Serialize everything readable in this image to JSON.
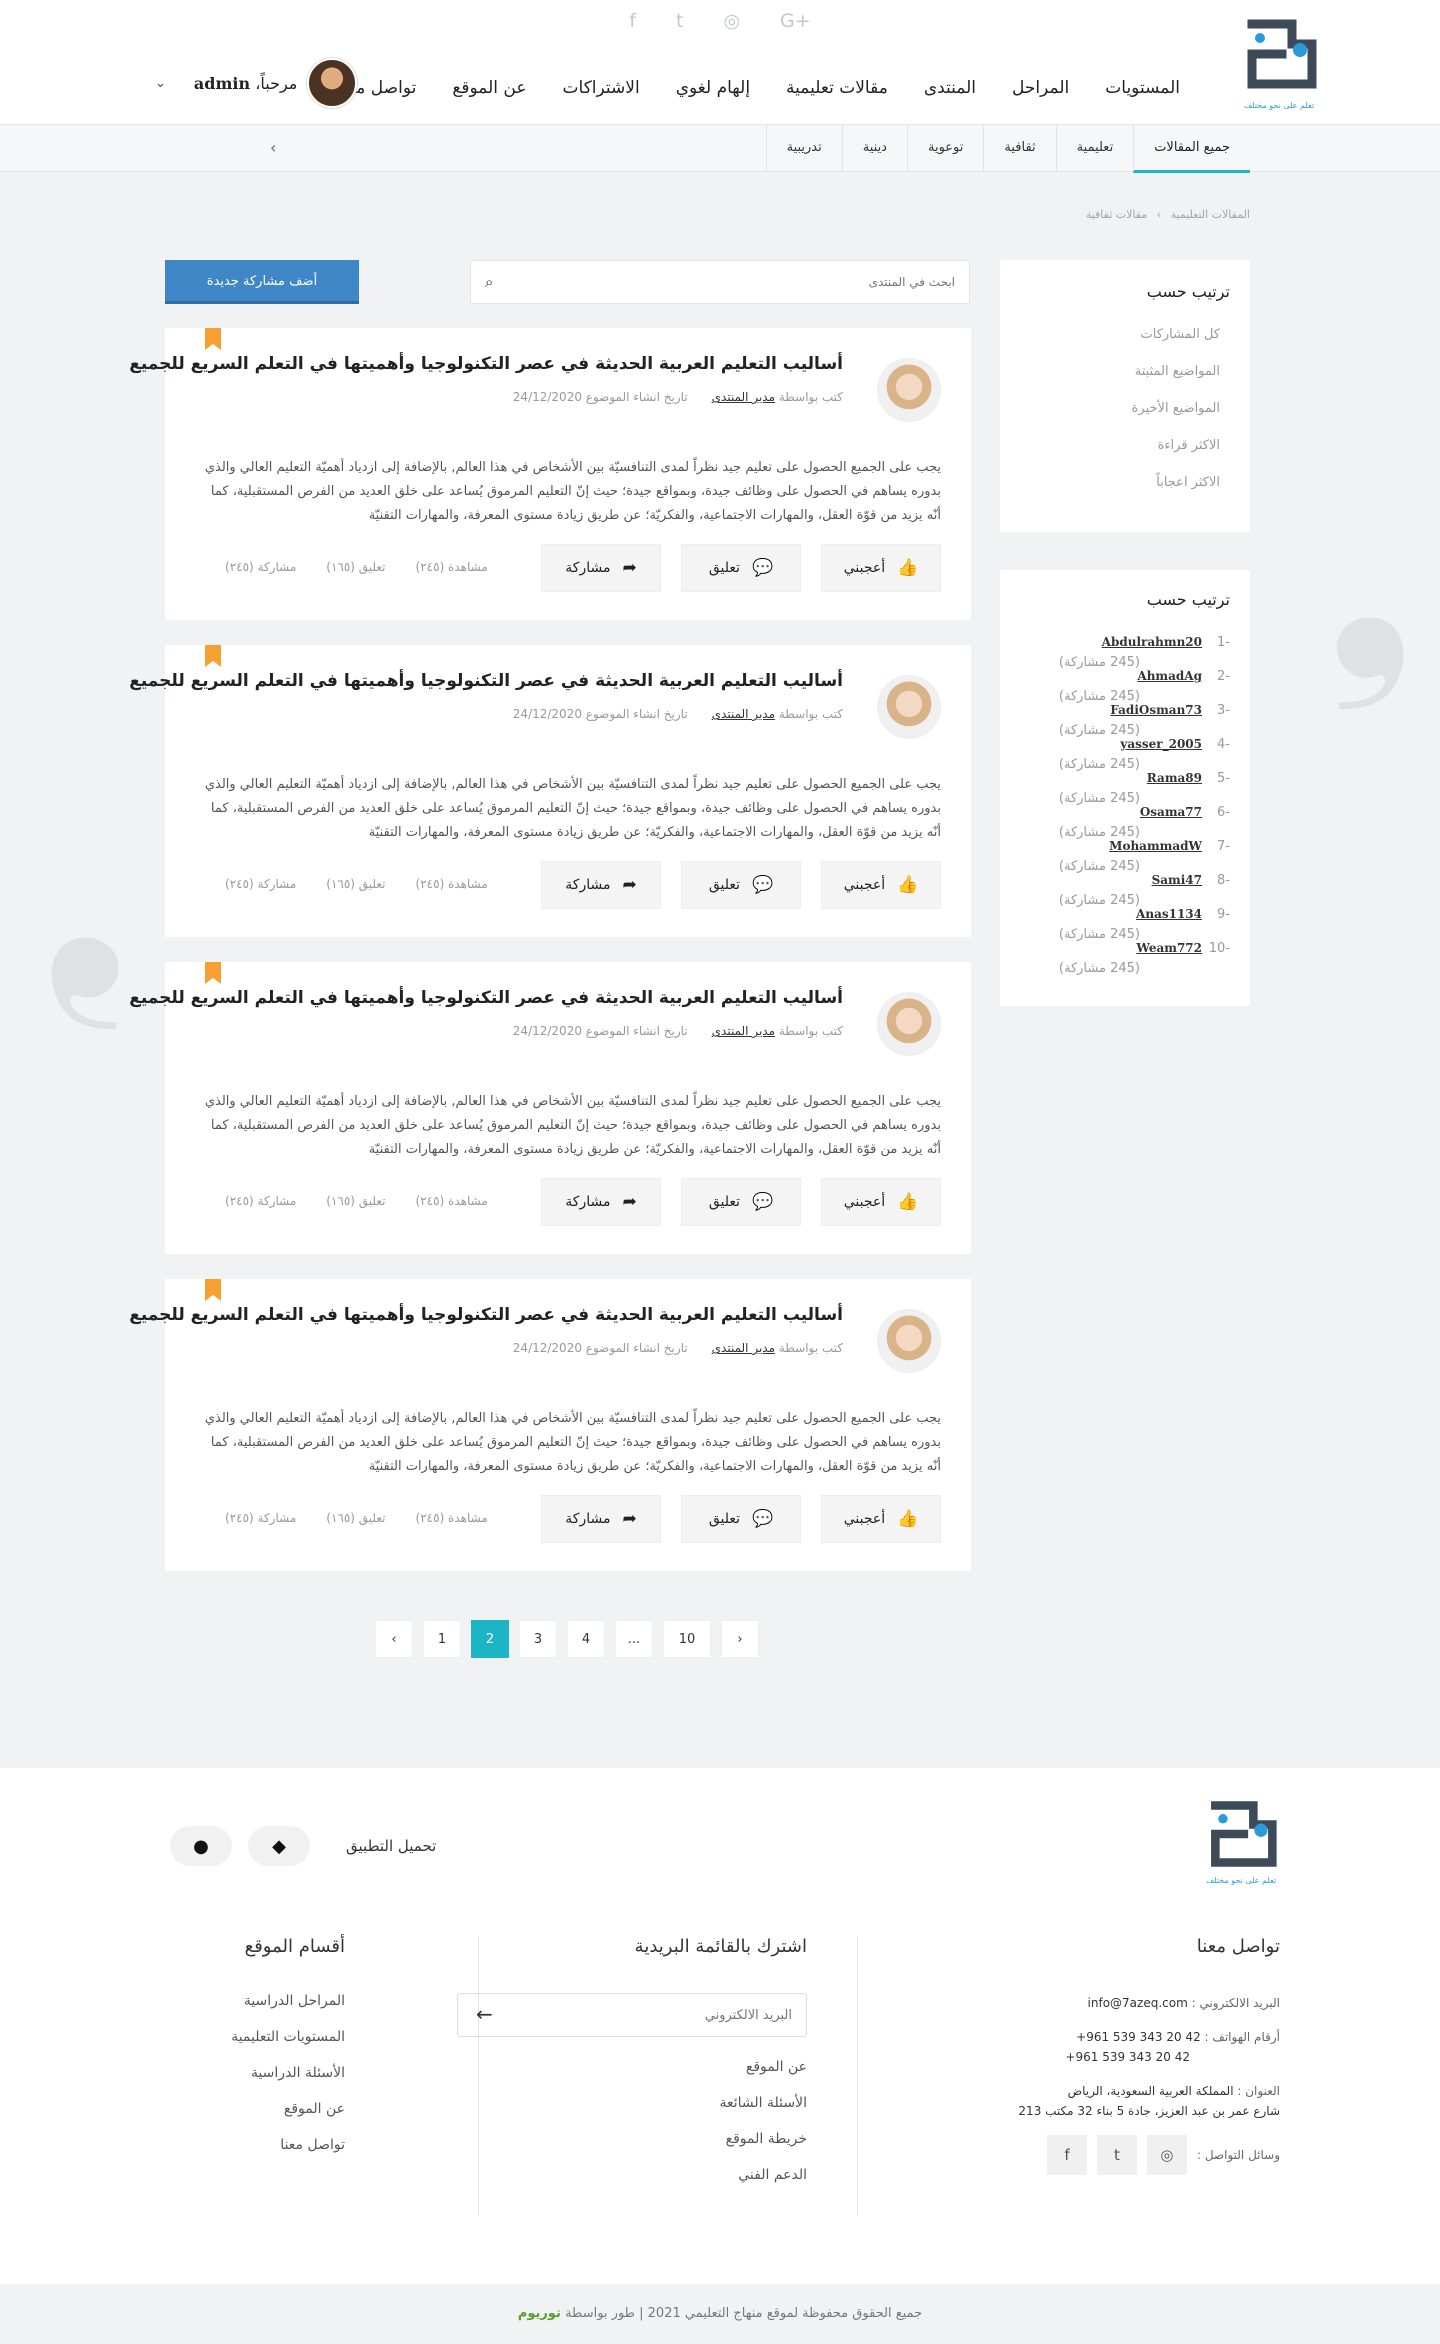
{
  "header": {
    "social": [
      "f",
      "t",
      "◎",
      "G+"
    ],
    "logo_tagline": "تعلم على نحو مختلف",
    "nav": [
      "المستويات",
      "المراحل",
      "المنتدى",
      "مقالات تعليمية",
      "إلهام لغوي",
      "الاشتراكات",
      "عن الموقع",
      "تواصل معنا"
    ],
    "user": {
      "greeting": "مرحباً،",
      "name": "admin",
      "chevron": "⌄"
    }
  },
  "subnav": {
    "tabs": [
      "جميع المقالات",
      "تعليمية",
      "ثقافية",
      "توعوية",
      "دينية",
      "تدريبية"
    ],
    "arrow": "›"
  },
  "breadcrumb": [
    "المقالات التعليمية",
    "›",
    "مقالات ثقافية"
  ],
  "search": {
    "placeholder": "ابحث في المنتدى",
    "icon": "⌕"
  },
  "add_button": "أضف مشاركة جديدة",
  "sort_box": {
    "title": "ترتيب حسب",
    "items": [
      "كل المشاركات",
      "المواضيع المثبتة",
      "المواضيع الأخيرة",
      "الاكثر قراءة",
      "الاكثر اعجاباً"
    ]
  },
  "leaders": {
    "title": "ترتيب حسب",
    "items": [
      {
        "num": "-1",
        "name": "Abdulrahmn20",
        "count": "(245 مشاركة)"
      },
      {
        "num": "-2",
        "name": "AhmadAg",
        "count": "(245 مشاركة)"
      },
      {
        "num": "-3",
        "name": "FadiOsman73",
        "count": "(245 مشاركة)"
      },
      {
        "num": "-4",
        "name": "yasser_2005",
        "count": "(245 مشاركة)"
      },
      {
        "num": "-5",
        "name": "Rama89",
        "count": "(245 مشاركة)"
      },
      {
        "num": "-6",
        "name": "Osama77",
        "count": "(245 مشاركة)"
      },
      {
        "num": "-7",
        "name": "MohammadW",
        "count": "(245 مشاركة)"
      },
      {
        "num": "-8",
        "name": "Sami47",
        "count": "(245 مشاركة)"
      },
      {
        "num": "-9",
        "name": "Anas1134",
        "count": "(245 مشاركة)"
      },
      {
        "num": "-10",
        "name": "Weam772",
        "count": "(245 مشاركة)"
      }
    ]
  },
  "posts": [
    {
      "title": "أساليب التعليم العربية الحديثة في عصر التكنولوجيا وأهميتها في التعلم السريع للجميع",
      "by_label": "كتب بواسطة",
      "author": "مدير المنتدى",
      "date_label": "تاريخ انشاء الموضوع",
      "date": "24/12/2020",
      "body": "يجب على الجميع الحصول على تعليم جيد نظراً لمدى التنافسيّة بين الأشخاص في هذا العالم, بالإضافة إلى ازدياد أهميّة التعليم العالي والذي بدوره يساهم في الحصول على وظائف جيدة، وبمواقع جيدة؛ حيث إنّ التعليم المرموق يُساعد على خلق العديد من الفرص المستقبلية، كما أنّه يزيد من قوّة العقل، والمهارات الاجتماعية، والفكريّة؛ عن طريق زيادة مستوى المعرفة، والمهارات التقنيّة",
      "like": "أعجبني",
      "comment": "تعليق",
      "share": "مشاركة",
      "views": "مشاهدة (٢٤٥)",
      "comments": "تعليق (١٦٥)",
      "shares": "مشاركة (٢٤٥)"
    },
    {
      "title": "أساليب التعليم العربية الحديثة في عصر التكنولوجيا وأهميتها في التعلم السريع للجميع",
      "by_label": "كتب بواسطة",
      "author": "مدير المنتدى",
      "date_label": "تاريخ انشاء الموضوع",
      "date": "24/12/2020",
      "body": "يجب على الجميع الحصول على تعليم جيد نظراً لمدى التنافسيّة بين الأشخاص في هذا العالم, بالإضافة إلى ازدياد أهميّة التعليم العالي والذي بدوره يساهم في الحصول على وظائف جيدة، وبمواقع جيدة؛ حيث إنّ التعليم المرموق يُساعد على خلق العديد من الفرص المستقبلية، كما أنّه يزيد من قوّة العقل، والمهارات الاجتماعية، والفكريّة؛ عن طريق زيادة مستوى المعرفة، والمهارات التقنيّة",
      "like": "أعجبني",
      "comment": "تعليق",
      "share": "مشاركة",
      "views": "مشاهدة (٢٤٥)",
      "comments": "تعليق (١٦٥)",
      "shares": "مشاركة (٢٤٥)"
    },
    {
      "title": "أساليب التعليم العربية الحديثة في عصر التكنولوجيا وأهميتها في التعلم السريع للجميع",
      "by_label": "كتب بواسطة",
      "author": "مدير المنتدى",
      "date_label": "تاريخ انشاء الموضوع",
      "date": "24/12/2020",
      "body": "يجب على الجميع الحصول على تعليم جيد نظراً لمدى التنافسيّة بين الأشخاص في هذا العالم, بالإضافة إلى ازدياد أهميّة التعليم العالي والذي بدوره يساهم في الحصول على وظائف جيدة، وبمواقع جيدة؛ حيث إنّ التعليم المرموق يُساعد على خلق العديد من الفرص المستقبلية، كما أنّه يزيد من قوّة العقل، والمهارات الاجتماعية، والفكريّة؛ عن طريق زيادة مستوى المعرفة، والمهارات التقنيّة",
      "like": "أعجبني",
      "comment": "تعليق",
      "share": "مشاركة",
      "views": "مشاهدة (٢٤٥)",
      "comments": "تعليق (١٦٥)",
      "shares": "مشاركة (٢٤٥)"
    },
    {
      "title": "أساليب التعليم العربية الحديثة في عصر التكنولوجيا وأهميتها في التعلم السريع للجميع",
      "by_label": "كتب بواسطة",
      "author": "مدير المنتدى",
      "date_label": "تاريخ انشاء الموضوع",
      "date": "24/12/2020",
      "body": "يجب على الجميع الحصول على تعليم جيد نظراً لمدى التنافسيّة بين الأشخاص في هذا العالم, بالإضافة إلى ازدياد أهميّة التعليم العالي والذي بدوره يساهم في الحصول على وظائف جيدة، وبمواقع جيدة؛ حيث إنّ التعليم المرموق يُساعد على خلق العديد من الفرص المستقبلية، كما أنّه يزيد من قوّة العقل، والمهارات الاجتماعية، والفكريّة؛ عن طريق زيادة مستوى المعرفة، والمهارات التقنيّة",
      "like": "أعجبني",
      "comment": "تعليق",
      "share": "مشاركة",
      "views": "مشاهدة (٢٤٥)",
      "comments": "تعليق (١٦٥)",
      "shares": "مشاركة (٢٤٥)"
    }
  ],
  "pagination": {
    "prev": "‹",
    "pages": [
      "1",
      "2",
      "3",
      "4",
      "...",
      "10"
    ],
    "active": "2",
    "next": "›"
  },
  "footer": {
    "logo_tagline": "تعلم على نحو مختلف",
    "app_label": "تحميل التطبيق",
    "contact": {
      "title": "تواصل معنا",
      "email_label": "البريد الالكتروني :",
      "email": "info@7azeq.com",
      "phones_label": "أرقام الهواتف :",
      "phone1": "+961 539 343 20 42",
      "phone2": "+961 539 343 20 42",
      "address_label": "العنوان :",
      "address1": "المملكة العربية السعودية، الرياض",
      "address2": "شارع عمر بن عبد العزيز، جادة 5 بناء 32 مكتب 213",
      "social_label": "وسائل التواصل :"
    },
    "newsletter": {
      "title": "اشترك بالقائمة البريدية",
      "placeholder": "البريد الالكتروني",
      "arrow": "←",
      "links": [
        "عن الموقع",
        "الأسئلة الشائعة",
        "خريطة الموقع",
        "الدعم الفني"
      ]
    },
    "sections": {
      "title": "أقسام الموقع",
      "links": [
        "المراحل الدراسية",
        "المستويات التعليمية",
        "الأسئلة الدراسية",
        "عن الموقع",
        "تواصل معنا"
      ]
    }
  },
  "copyright": {
    "text": "جميع الحقوق محفوظة لموقع منهاج التعليمي 2021 | طور بواسطة",
    "brand": "توريوم"
  },
  "colors": {
    "accent": "#1bb5c6",
    "primary_button": "#3f87c6",
    "bookmark": "#f5a030",
    "brand_green": "#5a9e2d"
  }
}
